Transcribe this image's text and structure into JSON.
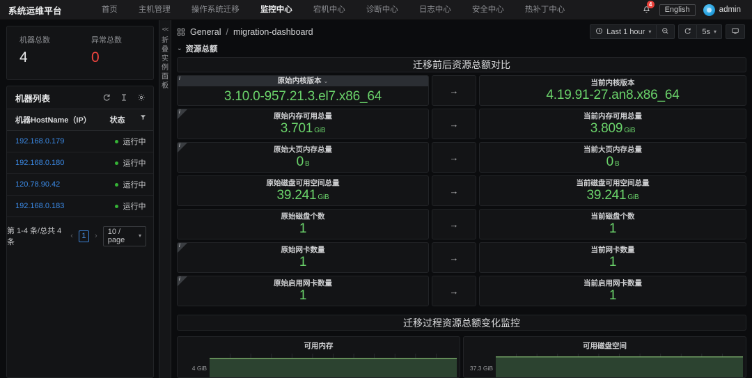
{
  "topnav": {
    "brand": "系统运维平台",
    "items": [
      {
        "label": "首页",
        "active": false
      },
      {
        "label": "主机管理",
        "active": false
      },
      {
        "label": "操作系统迁移",
        "active": false
      },
      {
        "label": "监控中心",
        "active": true
      },
      {
        "label": "宕机中心",
        "active": false
      },
      {
        "label": "诊断中心",
        "active": false
      },
      {
        "label": "日志中心",
        "active": false
      },
      {
        "label": "安全中心",
        "active": false
      },
      {
        "label": "热补丁中心",
        "active": false
      }
    ],
    "notification_badge": "4",
    "language_label": "English",
    "username": "admin"
  },
  "left_panel": {
    "stats": [
      {
        "label": "机器总数",
        "value": "4",
        "danger": false
      },
      {
        "label": "异常总数",
        "value": "0",
        "danger": true
      }
    ],
    "list": {
      "title": "机器列表",
      "columns": [
        "机器HostName（IP）",
        "状态"
      ],
      "rows": [
        {
          "ip": "192.168.0.179",
          "status": "运行中"
        },
        {
          "ip": "192.168.0.180",
          "status": "运行中"
        },
        {
          "ip": "120.78.90.42",
          "status": "运行中"
        },
        {
          "ip": "192.168.0.183",
          "status": "运行中"
        }
      ],
      "pagination": {
        "summary": "第 1-4 条/总共 4 条",
        "prev": "‹",
        "current_page": "1",
        "next": "›",
        "page_size": "10 / page"
      }
    },
    "collapse_label": "折叠实例面板",
    "collapse_chevron": "<<"
  },
  "dashboard": {
    "breadcrumb_folder": "General",
    "breadcrumb_sep": "/",
    "breadcrumb_name": "migration-dashboard",
    "toolbar": {
      "time_range": "Last 1 hour",
      "refresh_interval": "5s"
    },
    "section_title": "资源总额",
    "banner_compare": "迁移前后资源总额对比",
    "banner_monitor": "迁移过程资源总额变化监控",
    "arrow": "→",
    "comparisons": [
      {
        "left_title": "原始内核版本",
        "left_value": "3.10.0-957.21.3.el7.x86_64",
        "left_unit": "",
        "right_title": "当前内核版本",
        "right_value": "4.19.91-27.an8.x86_64",
        "right_unit": "",
        "info": true,
        "hovered": true
      },
      {
        "left_title": "原始内存可用总量",
        "left_value": "3.701",
        "left_unit": "GiB",
        "right_title": "当前内存可用总量",
        "right_value": "3.809",
        "right_unit": "GiB",
        "info": true,
        "hovered": false
      },
      {
        "left_title": "原始大页内存总量",
        "left_value": "0",
        "left_unit": "B",
        "right_title": "当前大页内存总量",
        "right_value": "0",
        "right_unit": "B",
        "info": true,
        "hovered": false
      },
      {
        "left_title": "原始磁盘可用空间总量",
        "left_value": "39.241",
        "left_unit": "GiB",
        "right_title": "当前磁盘可用空间总量",
        "right_value": "39.241",
        "right_unit": "GiB",
        "info": false,
        "hovered": false
      },
      {
        "left_title": "原始磁盘个数",
        "left_value": "1",
        "left_unit": "",
        "right_title": "当前磁盘个数",
        "right_value": "1",
        "right_unit": "",
        "info": false,
        "hovered": false
      },
      {
        "left_title": "原始网卡数量",
        "left_value": "1",
        "left_unit": "",
        "right_title": "当前网卡数量",
        "right_value": "1",
        "right_unit": "",
        "info": true,
        "hovered": false
      },
      {
        "left_title": "原始启用网卡数量",
        "left_value": "1",
        "left_unit": "",
        "right_title": "当前启用网卡数量",
        "right_value": "1",
        "right_unit": "",
        "info": true,
        "hovered": false
      }
    ]
  },
  "chart_data": [
    {
      "type": "area",
      "title": "可用内存",
      "xlabel": "",
      "ylabel": "",
      "ytick_labels": [
        "4 GiB"
      ],
      "series": [
        {
          "name": "可用内存",
          "values": [
            4.0,
            4.0,
            4.0,
            4.0,
            4.0,
            4.0,
            4.0,
            4.0,
            4.0,
            4.0,
            4.0,
            4.0
          ]
        }
      ],
      "ylim": [
        0,
        4.3
      ],
      "grid": true,
      "legend": "none",
      "line_color": "#7eb26d",
      "fill_color": "#2c4330"
    },
    {
      "type": "area",
      "title": "可用磁盘空间",
      "xlabel": "",
      "ylabel": "",
      "ytick_labels": [
        "37.3 GiB"
      ],
      "series": [
        {
          "name": "可用磁盘空间",
          "values": [
            37.3,
            37.3,
            37.3,
            37.3,
            37.3,
            37.3,
            37.3,
            37.3,
            37.3,
            37.3,
            37.3,
            37.3
          ]
        }
      ],
      "ylim": [
        0,
        38
      ],
      "grid": true,
      "legend": "none",
      "line_color": "#7eb26d",
      "fill_color": "#2c4330"
    }
  ]
}
